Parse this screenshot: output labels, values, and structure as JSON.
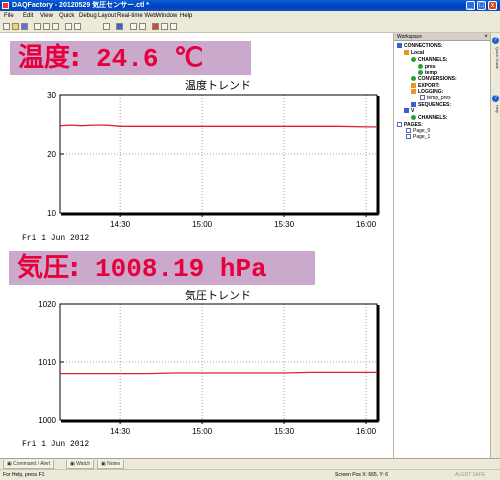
{
  "window": {
    "title": "DAQFactory - 20120529 気圧センサー.ctl *",
    "controls": {
      "minimize": "_",
      "maximize": "□",
      "close": "x"
    }
  },
  "menu": [
    "File",
    "Edit",
    "View",
    "Quick",
    "Debug",
    "Layout",
    "Real-time Web",
    "Window",
    "Help"
  ],
  "toolbar_icons": [
    "new-icon",
    "open-icon",
    "save-icon",
    "cut-icon",
    "copy-icon",
    "paste-icon",
    "undo-icon",
    "redo-icon",
    "print-icon",
    "help-icon",
    "tool-icon",
    "tool-icon",
    "flask-icon",
    "chart-icon",
    "grid-icon"
  ],
  "temperature": {
    "label": "温度:",
    "value": "24.6 ℃",
    "chart_title": "温度トレンド",
    "date": "Fri 1 Jun 2012"
  },
  "pressure": {
    "label": "気圧:",
    "value": "1008.19 hPa",
    "chart_title": "気圧トレンド",
    "date": "Fri 1 Jun 2012"
  },
  "chart_data": [
    {
      "type": "line",
      "title": "温度トレンド",
      "ylim": [
        10,
        30
      ],
      "y_ticks": [
        "30",
        "20",
        "10"
      ],
      "x_ticks": [
        "14:30",
        "15:00",
        "15:30",
        "16:00"
      ],
      "x_tick_minutes": [
        30,
        60,
        90,
        120
      ],
      "x_range_minutes": [
        8,
        124
      ],
      "grid": true,
      "line_color": "#e0202a",
      "series": [
        {
          "x": [
            8,
            12,
            16,
            20,
            25,
            30,
            40,
            50,
            60,
            70,
            80,
            90,
            100,
            110,
            120,
            124
          ],
          "y": [
            24.8,
            24.9,
            24.8,
            24.9,
            24.9,
            24.7,
            24.7,
            24.7,
            24.7,
            24.7,
            24.7,
            24.7,
            24.7,
            24.7,
            24.6,
            24.6
          ]
        }
      ]
    },
    {
      "type": "line",
      "title": "気圧トレンド",
      "ylim": [
        1000,
        1020
      ],
      "y_ticks": [
        "1020",
        "1010",
        "1000"
      ],
      "x_ticks": [
        "14:30",
        "15:00",
        "15:30",
        "16:00"
      ],
      "x_tick_minutes": [
        30,
        60,
        90,
        120
      ],
      "x_range_minutes": [
        8,
        124
      ],
      "grid": true,
      "line_color": "#e0202a",
      "series": [
        {
          "x": [
            8,
            20,
            30,
            40,
            50,
            60,
            70,
            80,
            90,
            100,
            110,
            120,
            124
          ],
          "y": [
            1008.0,
            1008.0,
            1008.0,
            1008.0,
            1008.1,
            1008.1,
            1008.1,
            1008.1,
            1008.1,
            1008.2,
            1008.2,
            1008.2,
            1008.2
          ]
        }
      ]
    }
  ],
  "workspace": {
    "title": "Workspace",
    "tree": [
      {
        "label": "CONNECTIONS:",
        "icon": "connections-icon"
      },
      {
        "label": "Local",
        "icon": "local-icon"
      },
      {
        "label": "CHANNELS:",
        "icon": "channels-icon"
      },
      {
        "label": "pres",
        "icon": "channel-icon"
      },
      {
        "label": "temp",
        "icon": "channel-icon"
      },
      {
        "label": "CONVERSIONS:",
        "icon": "conversions-icon"
      },
      {
        "label": "EXPORT:",
        "icon": "export-icon"
      },
      {
        "label": "LOGGING:",
        "icon": "logging-icon"
      },
      {
        "label": "temp_pres",
        "icon": "log-icon"
      },
      {
        "label": "SEQUENCES:",
        "icon": "sequences-icon"
      },
      {
        "label": "V",
        "icon": "v-icon"
      },
      {
        "label": "CHANNELS:",
        "icon": "channels-icon"
      },
      {
        "label": "PAGES:",
        "icon": "pages-icon"
      },
      {
        "label": "Page_0",
        "icon": "page-icon"
      },
      {
        "label": "Page_1",
        "icon": "page-icon"
      }
    ]
  },
  "side_tabs": [
    "Quick Guide",
    "Help"
  ],
  "bottom_tabs": [
    "Command / Alert",
    "Watch",
    "Notes"
  ],
  "status": {
    "help": "For Help, press F1",
    "pos": "Screen Pos X: 665, Y: 6",
    "alert": "ALERT SAFE"
  }
}
